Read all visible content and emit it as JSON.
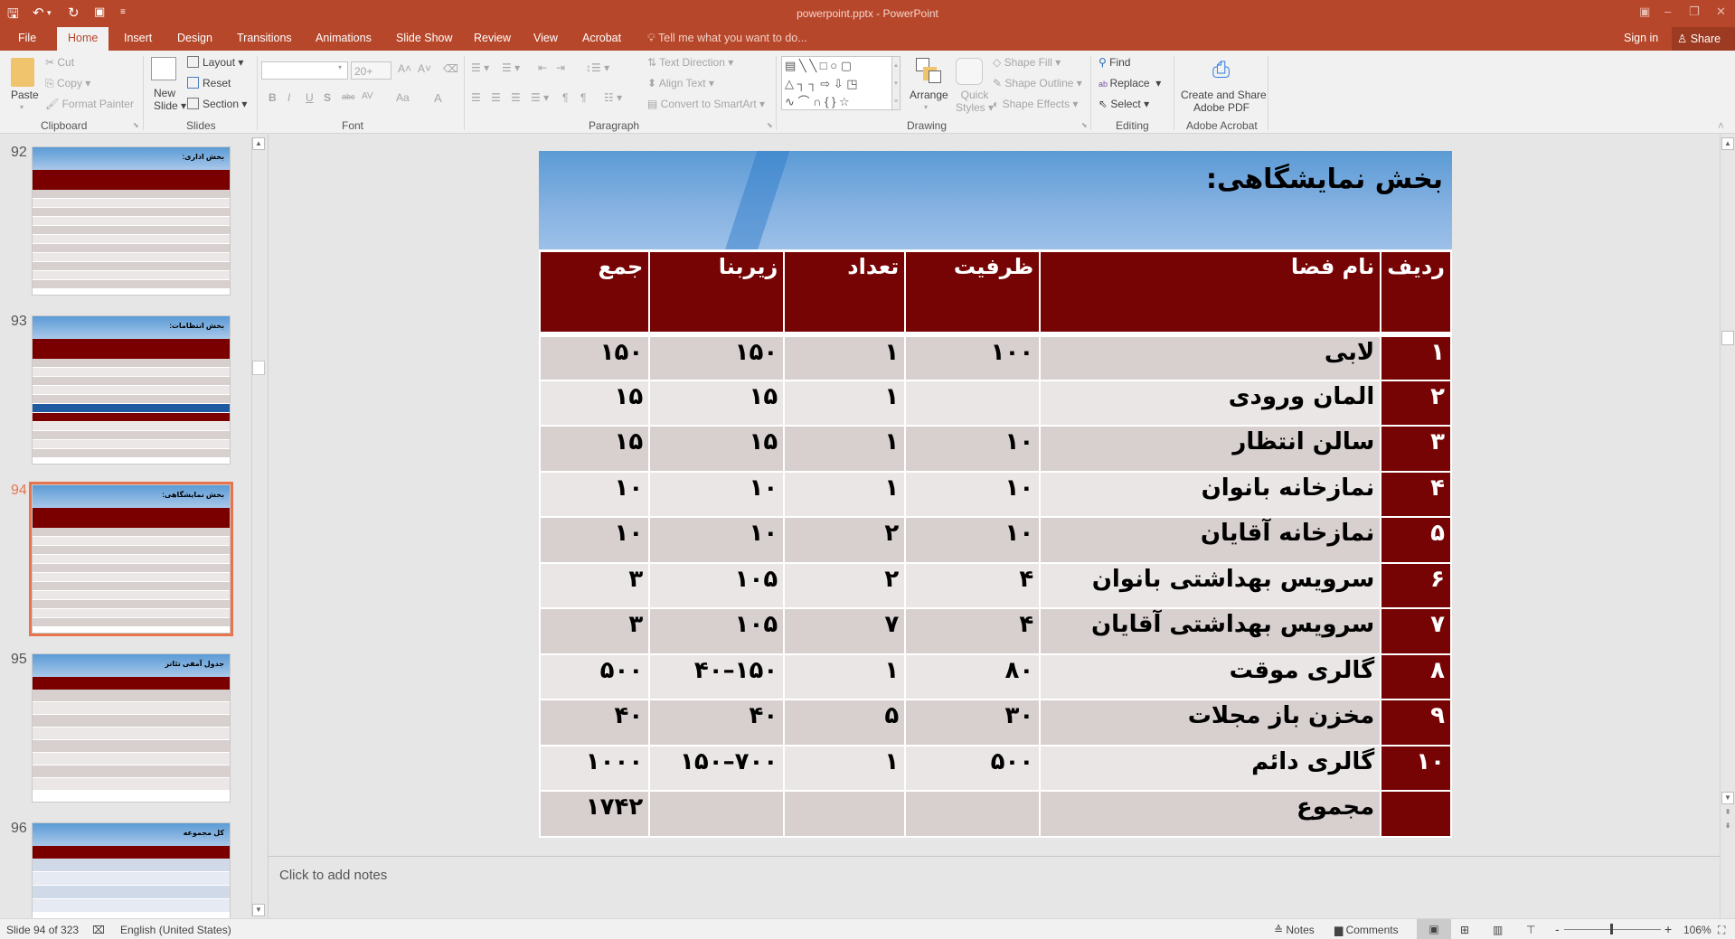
{
  "window": {
    "title": "powerpoint.pptx - PowerPoint",
    "quick_access": [
      "save-icon",
      "undo-icon",
      "redo-icon",
      "present-icon",
      "customize-icon"
    ],
    "controls": [
      "ribbon-display-icon",
      "minimize-icon",
      "restore-icon",
      "close-icon"
    ]
  },
  "tabs": [
    {
      "label": "File"
    },
    {
      "label": "Home",
      "active": true
    },
    {
      "label": "Insert"
    },
    {
      "label": "Design"
    },
    {
      "label": "Transitions"
    },
    {
      "label": "Animations"
    },
    {
      "label": "Slide Show"
    },
    {
      "label": "Review"
    },
    {
      "label": "View"
    },
    {
      "label": "Acrobat"
    }
  ],
  "tell_me": "Tell me what you want to do...",
  "sign_in": "Sign in",
  "share": "Share",
  "ribbon": {
    "clipboard": {
      "paste": "Paste",
      "cut": "Cut",
      "copy": "Copy",
      "format_painter": "Format Painter",
      "label": "Clipboard"
    },
    "slides": {
      "new_slide_1": "New",
      "new_slide_2": "Slide",
      "layout": "Layout",
      "reset": "Reset",
      "section": "Section",
      "label": "Slides"
    },
    "font": {
      "font_name": "",
      "font_size": "20+",
      "label": "Font",
      "bold": "B",
      "italic": "I",
      "underline": "U",
      "shadow": "S",
      "strike": "abc",
      "spacing": "AV",
      "case": "Aa",
      "color": "A"
    },
    "paragraph": {
      "text_direction": "Text Direction",
      "align_text": "Align Text",
      "convert": "Convert to SmartArt",
      "label": "Paragraph"
    },
    "drawing": {
      "arrange": "Arrange",
      "quick_styles_1": "Quick",
      "quick_styles_2": "Styles",
      "shape_fill": "Shape Fill",
      "shape_outline": "Shape Outline",
      "shape_effects": "Shape Effects",
      "label": "Drawing"
    },
    "editing": {
      "find": "Find",
      "replace": "Replace",
      "select": "Select",
      "label": "Editing"
    },
    "acrobat": {
      "create_1": "Create and Share",
      "create_2": "Adobe PDF",
      "label": "Adobe Acrobat"
    }
  },
  "thumbnails": [
    {
      "num": "92",
      "title": "بخش اداری:"
    },
    {
      "num": "93",
      "title": "بخش انتظامات:"
    },
    {
      "num": "94",
      "title": "بخش نمایشگاهی:",
      "selected": true
    },
    {
      "num": "95",
      "title": "جدول آمفی تئاتر"
    },
    {
      "num": "96",
      "title": "کل مجموعه"
    }
  ],
  "slide": {
    "title": "بخش نمایشگاهی:",
    "headers": [
      "ردیف",
      "نام فضا",
      "ظرفیت",
      "تعداد",
      "زیربنا",
      "جمع"
    ],
    "rows": [
      [
        "۱",
        "لابی",
        "۱۰۰",
        "۱",
        "۱۵۰",
        "۱۵۰"
      ],
      [
        "۲",
        "المان ورودی",
        "",
        "۱",
        "۱۵",
        "۱۵"
      ],
      [
        "۳",
        "سالن انتظار",
        "۱۰",
        "۱",
        "۱۵",
        "۱۵"
      ],
      [
        "۴",
        "نمازخانه بانوان",
        "۱۰",
        "۱",
        "۱۰",
        "۱۰"
      ],
      [
        "۵",
        "نمازخانه آقایان",
        "۱۰",
        "۲",
        "۱۰",
        "۱۰"
      ],
      [
        "۶",
        "سرویس بهداشتی بانوان",
        "۴",
        "۲",
        "۱۰۵",
        "۳"
      ],
      [
        "۷",
        "سرویس بهداشتی آقایان",
        "۴",
        "۷",
        "۱۰۵",
        "۳"
      ],
      [
        "۸",
        "گالری موقت",
        "۸۰",
        "۱",
        "۱۵۰–۴۰",
        "۵۰۰"
      ],
      [
        "۹",
        "مخزن باز مجلات",
        "۳۰",
        "۵",
        "۴۰",
        "۴۰"
      ],
      [
        "۱۰",
        "گالری دائم",
        "۵۰۰",
        "۱",
        "۷۰۰–۱۵۰",
        "۱۰۰۰"
      ]
    ],
    "total_label": "مجموع",
    "total_value": "۱۷۴۲"
  },
  "notes_placeholder": "Click to add notes",
  "status": {
    "slide_info": "Slide 94 of 323",
    "language": "English (United States)",
    "notes": "Notes",
    "comments": "Comments",
    "zoom": "106%"
  },
  "colors": {
    "accent": "#b7472a",
    "table_header": "#760404",
    "row_odd": "#d8cfcf",
    "row_even": "#ebe6e6",
    "selection": "#e8734f"
  }
}
